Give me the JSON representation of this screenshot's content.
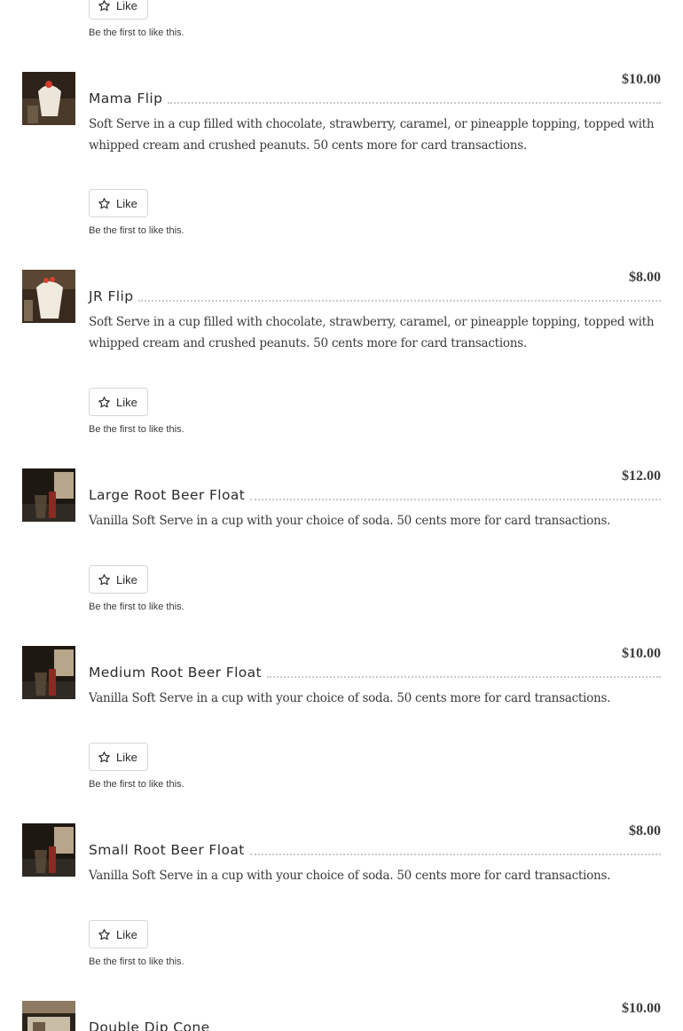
{
  "like_label": "Like",
  "first_like_text": "Be the first to like this.",
  "items": [
    {
      "title": "Mama Flip",
      "price": "$10.00",
      "description": "Soft Serve in a cup filled with chocolate, strawberry, caramel, or pineapple topping, topped with whipped cream and crushed peanuts. 50 cents more for card transactions."
    },
    {
      "title": "JR Flip",
      "price": "$8.00",
      "description": "Soft Serve in a cup filled with chocolate, strawberry, caramel, or pineapple topping, topped with whipped cream and crushed peanuts. 50 cents more for card transactions."
    },
    {
      "title": "Large Root Beer Float",
      "price": "$12.00",
      "description": "Vanilla Soft Serve in a cup with your choice of soda. 50 cents more for card transactions."
    },
    {
      "title": "Medium Root Beer Float",
      "price": "$10.00",
      "description": "Vanilla Soft Serve in a cup with your choice of soda. 50 cents more for card transactions."
    },
    {
      "title": "Small Root Beer Float",
      "price": "$8.00",
      "description": "Vanilla Soft Serve in a cup with your choice of soda. 50 cents more for card transactions."
    },
    {
      "title": "Double Dip Cone",
      "price": "$10.00",
      "description": ""
    }
  ]
}
